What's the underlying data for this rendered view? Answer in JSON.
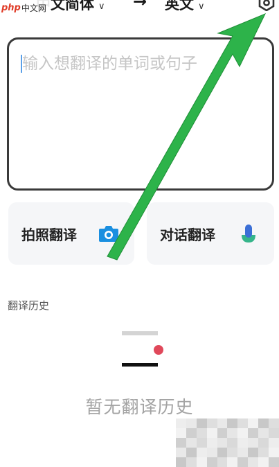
{
  "header": {
    "source_language": "中文简体",
    "swap_icon": "arrow-right-icon",
    "target_language": "英文",
    "dropdown_icon": "chevron-down-icon",
    "settings_icon": "settings-icon"
  },
  "input": {
    "placeholder": "输入想翻译的单词或句子",
    "value": ""
  },
  "actions": {
    "photo_label": "拍照翻译",
    "photo_icon": "camera-icon",
    "photo_icon_color": "#1a8fe0",
    "voice_label": "对话翻译",
    "voice_icon": "microphone-icon",
    "voice_icon_color": "#3b6fd6"
  },
  "history": {
    "title": "翻译历史",
    "empty_text": "暂无翻译历史",
    "empty_illustration": "empty-list-illustration",
    "dot_color": "#e0485a"
  },
  "watermark": {
    "brand": "php",
    "site": "中文网"
  },
  "annotation": {
    "arrow_color": "#2db34a",
    "points_to": "settings-icon"
  }
}
